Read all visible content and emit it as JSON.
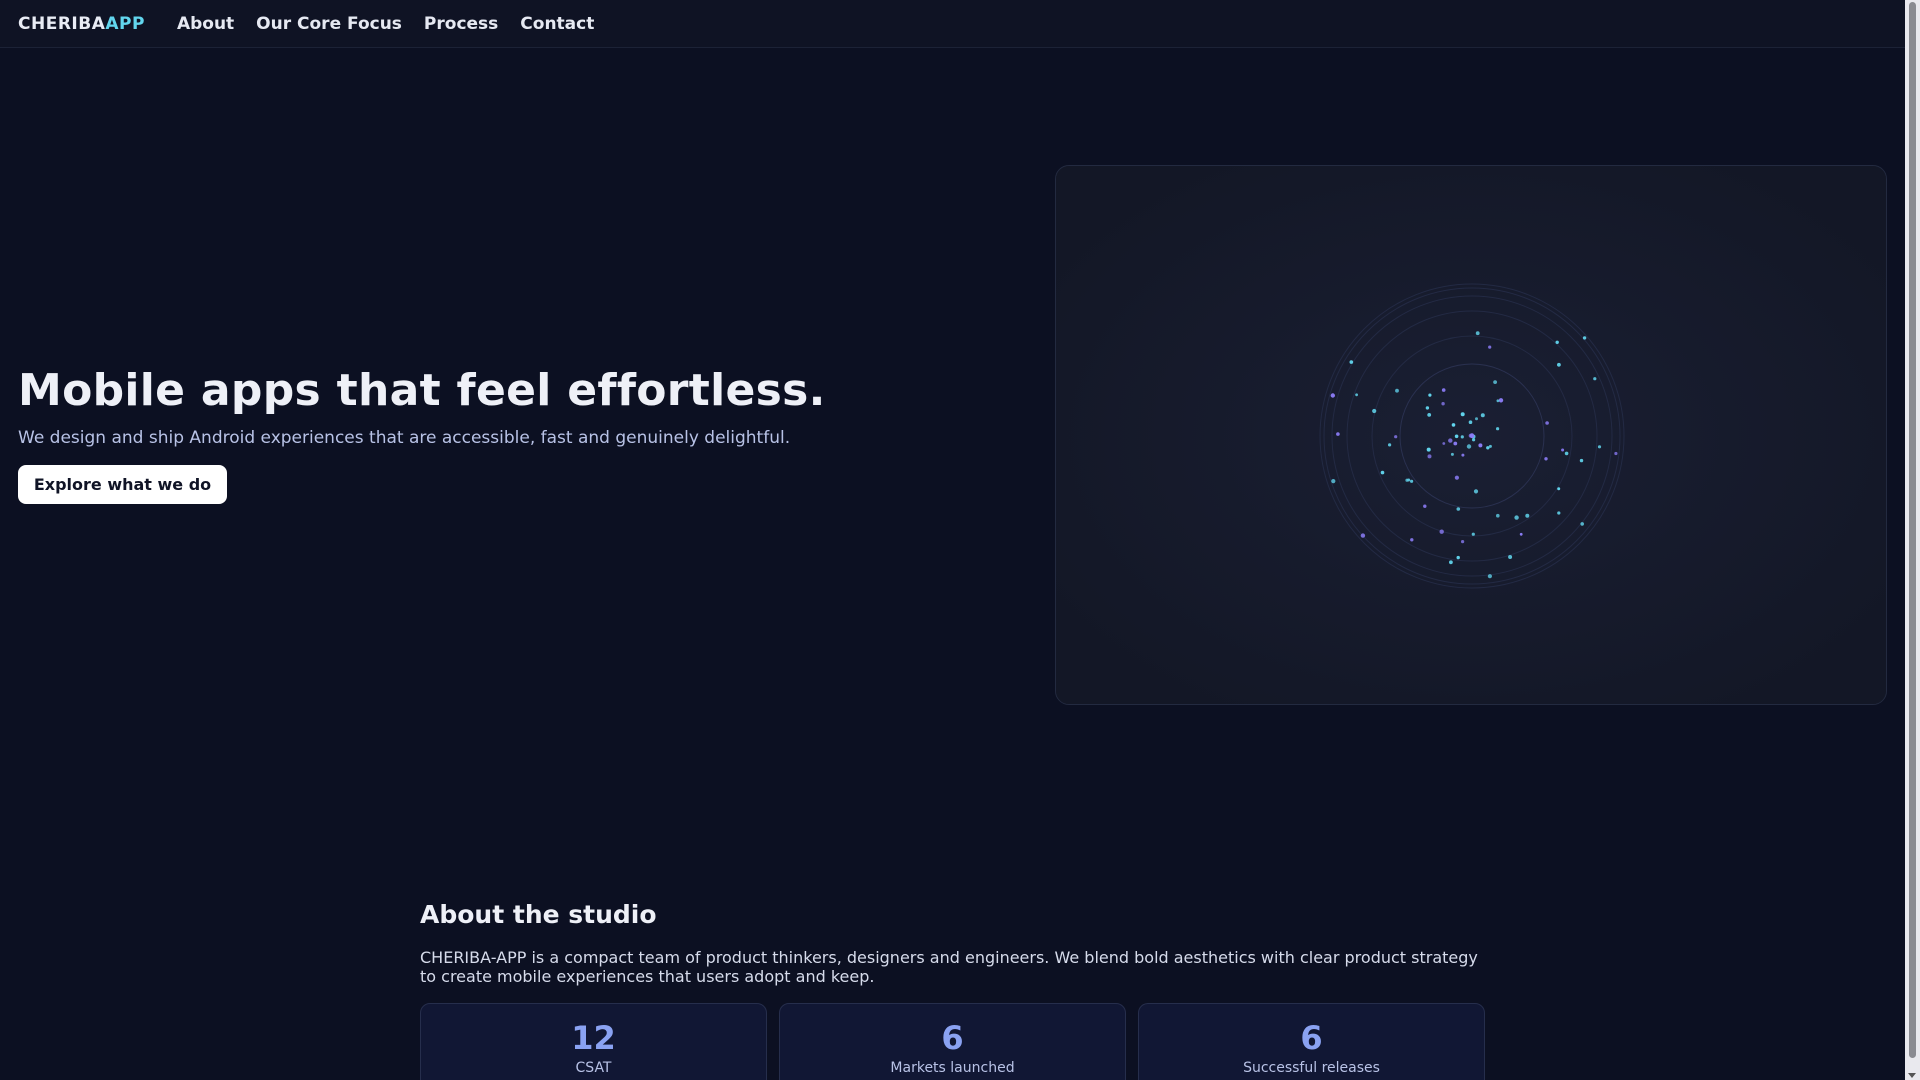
{
  "nav": {
    "brand_main": "CHERIBA",
    "brand_accent": "APP",
    "links": [
      "About",
      "Our Core Focus",
      "Process",
      "Contact"
    ]
  },
  "hero": {
    "title": "Mobile apps that feel effortless.",
    "subtitle": "We design and ship Android experiences that are accessible, fast and genuinely delightful.",
    "cta_label": "Explore what we do"
  },
  "about": {
    "title": "About the studio",
    "body": "CHERIBA-APP is a compact team of product thinkers, designers and engineers. We blend bold aesthetics with clear product strategy to create mobile experiences that users adopt and keep.",
    "stats": [
      {
        "value": "12",
        "label": "CSAT"
      },
      {
        "value": "6",
        "label": "Markets launched"
      },
      {
        "value": "6",
        "label": "Successful releases"
      }
    ]
  },
  "colors": {
    "background": "#0c1022",
    "accent_cyan": "#62d6ee",
    "accent_purple": "#8b7cf6",
    "stat_value": "#8aa2f2"
  }
}
